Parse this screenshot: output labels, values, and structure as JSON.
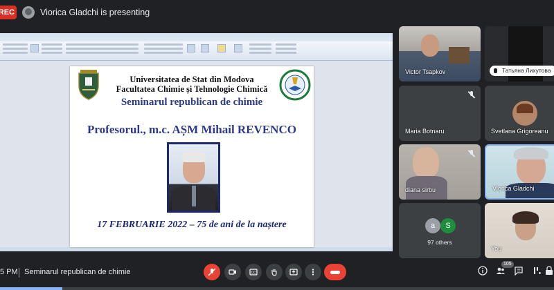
{
  "topbar": {
    "rec_label": "REC",
    "presenting_text": "Viorica Gladchi is presenting"
  },
  "document": {
    "university": "Universitatea de Stat din Modova",
    "faculty": "Facultatea Chimie și Tehnologie Chimică",
    "seminar": "Seminarul republican de chimie",
    "professor": "Profesorul., m.c. AȘM Mihail REVENCO",
    "date_line": "17 FEBRUARIE 2022 – 75 de ani de la naștere"
  },
  "participants": [
    {
      "name": "Victor Tsapkov",
      "muted": false
    },
    {
      "name": "Татьяна Лихутова",
      "muted": false
    },
    {
      "name": "Maria Botnaru",
      "muted": true
    },
    {
      "name": "Svetlana Grigoreanu",
      "muted": false
    },
    {
      "name": "diana sirbu",
      "muted": true
    },
    {
      "name": "Viorica Gladchi",
      "muted": false
    },
    {
      "name": "You",
      "muted": false
    }
  ],
  "others": {
    "avatars": [
      "a",
      "S"
    ],
    "label": "97 others"
  },
  "bottombar": {
    "time": "5 PM",
    "meeting_name": "Seminarul republican de chimie",
    "participant_count": "105"
  },
  "colors": {
    "background": "#202124",
    "tile": "#3c4043",
    "danger": "#ea4335",
    "accent": "#8ab4f8",
    "others_a": "#9aa0a6",
    "others_s": "#1e8e3e"
  },
  "icons": [
    "mic-off-icon",
    "camera-icon",
    "captions-icon",
    "raise-hand-icon",
    "present-icon",
    "more-icon",
    "hangup-icon",
    "info-icon",
    "people-icon",
    "chat-icon",
    "activities-icon",
    "lock-icon"
  ]
}
